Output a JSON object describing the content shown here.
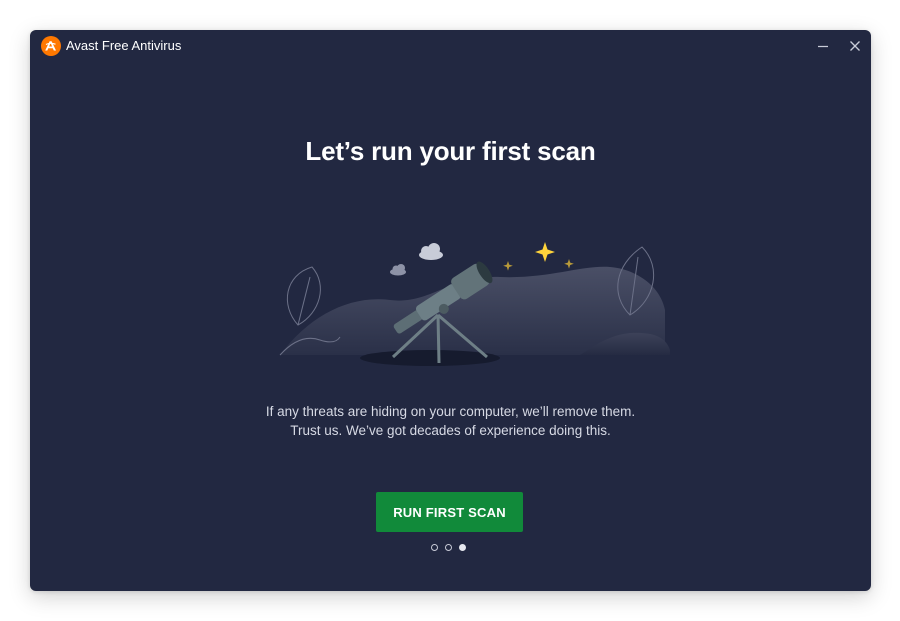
{
  "app": {
    "title": "Avast Free Antivirus",
    "brand_color": "#ff7800"
  },
  "window_controls": {
    "minimize_icon": "minimize-icon",
    "close_icon": "close-icon"
  },
  "onboarding": {
    "headline": "Let’s run your first scan",
    "description_lines": [
      "If any threats are hiding on your computer, we’ll remove them.",
      "Trust us. We’ve got decades of experience doing this."
    ],
    "cta_label": "RUN FIRST SCAN",
    "cta_color": "#118a3a",
    "pagination": {
      "total": 3,
      "active_index": 2
    }
  },
  "theme": {
    "background": "#222841",
    "text_primary": "#ffffff",
    "text_secondary": "#d6d9e4",
    "star_color": "#ffd43b"
  },
  "illustration": {
    "icons": [
      "telescope-icon",
      "cloud-icon",
      "star-icon",
      "leaf-icon",
      "hill-icon"
    ]
  }
}
